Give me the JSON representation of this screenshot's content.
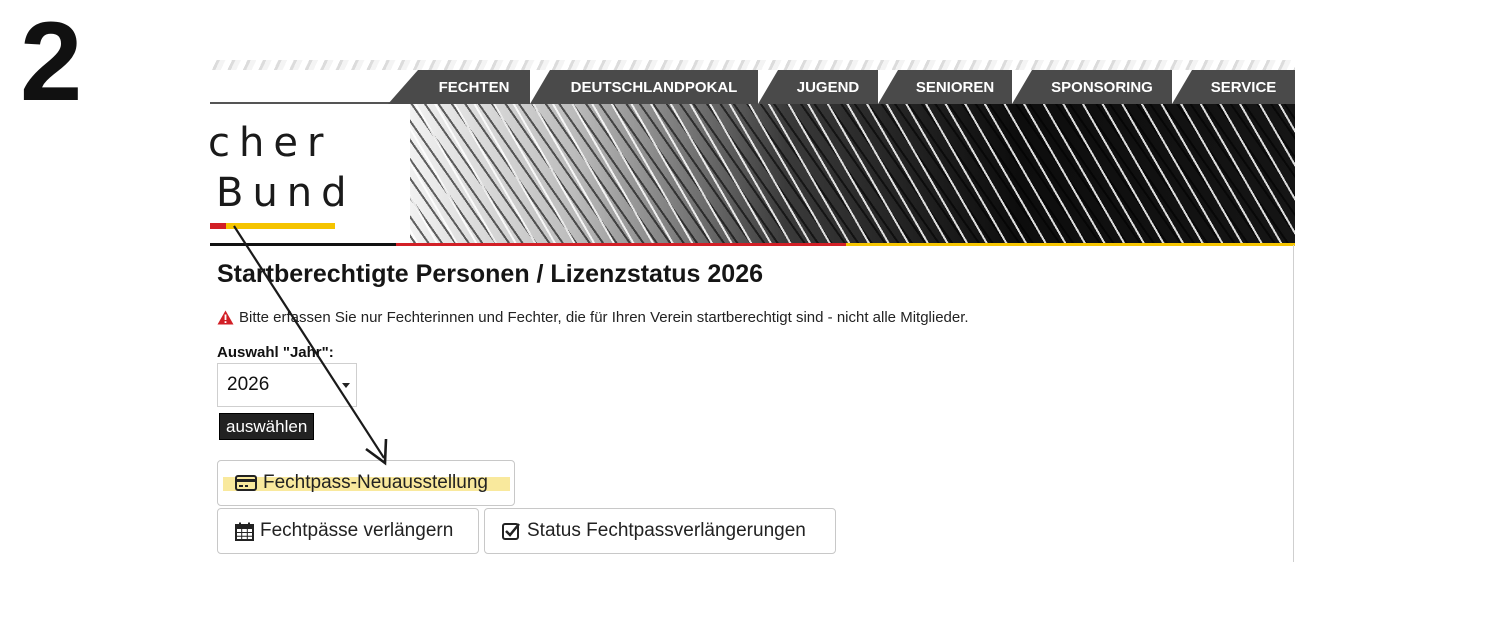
{
  "step_number": "2",
  "nav": {
    "tabs": [
      {
        "label": "FECHTEN"
      },
      {
        "label": "DEUTSCHLANDPOKAL"
      },
      {
        "label": "JUGEND"
      },
      {
        "label": "SENIOREN"
      },
      {
        "label": "SPONSORING"
      },
      {
        "label": "SERVICE"
      }
    ]
  },
  "logo": {
    "line1": "cher",
    "line2": "Bund"
  },
  "main": {
    "title": "Startberechtigte Personen / Lizenzstatus 2026",
    "warning": "Bitte erfassen Sie nur Fechterinnen und Fechter, die für Ihren Verein startberechtigt sind - nicht alle Mitglieder.",
    "year_label": "Auswahl \"Jahr\":",
    "year_value": "2026",
    "select_button": "auswählen",
    "buttons": {
      "new_pass": "Fechtpass-Neuausstellung",
      "extend": "Fechtpässe verlängern",
      "status": "Status Fechtpassverlängerungen"
    }
  },
  "colors": {
    "nav_bg": "#4a4a4a",
    "red": "#d21f26",
    "yellow": "#f5c400",
    "highlight": "#f8e58c"
  },
  "icons": {
    "warning": "warning-triangle-icon",
    "new_pass": "credit-card-icon",
    "extend": "calendar-icon",
    "status": "checkbox-icon"
  }
}
